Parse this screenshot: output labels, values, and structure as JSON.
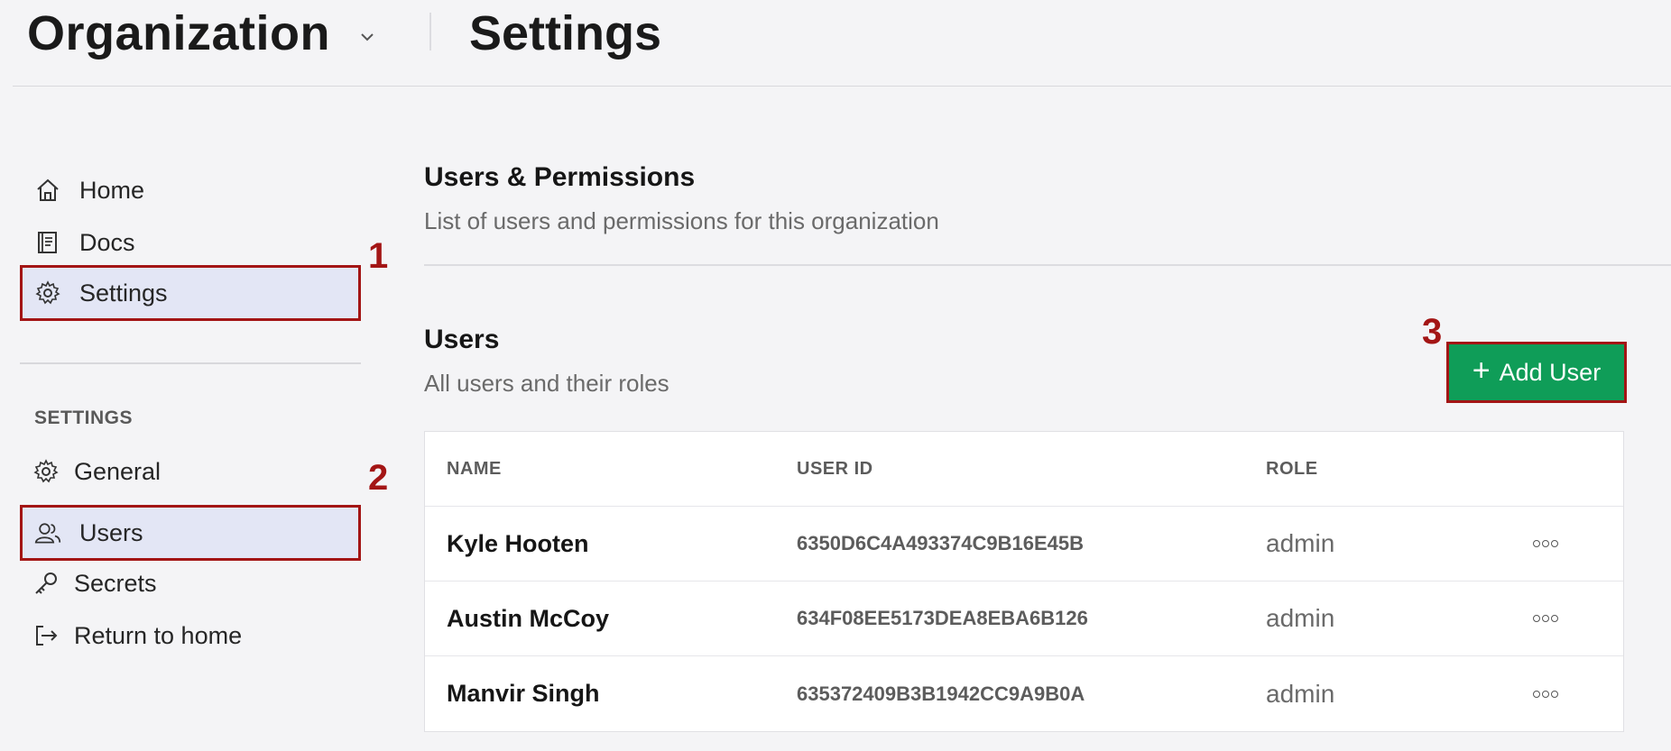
{
  "header": {
    "org_label": "Organization",
    "page_title": "Settings"
  },
  "sidebar": {
    "items": [
      {
        "label": "Home",
        "icon": "home-icon"
      },
      {
        "label": "Docs",
        "icon": "book-icon"
      },
      {
        "label": "Settings",
        "icon": "gear-icon",
        "active": true
      }
    ],
    "section_heading": "SETTINGS",
    "settings_items": [
      {
        "label": "General",
        "icon": "gear-icon"
      },
      {
        "label": "Users",
        "icon": "users-icon",
        "active": true
      },
      {
        "label": "Secrets",
        "icon": "key-icon"
      },
      {
        "label": "Return to home",
        "icon": "exit-icon"
      }
    ]
  },
  "markers": [
    "1",
    "2",
    "3"
  ],
  "main": {
    "permissions": {
      "title": "Users & Permissions",
      "subtitle": "List of users and permissions for this organization"
    },
    "users": {
      "title": "Users",
      "subtitle": "All users and their roles",
      "add_button_label": "Add User",
      "columns": [
        "NAME",
        "USER ID",
        "ROLE"
      ],
      "rows": [
        {
          "name": "Kyle Hooten",
          "user_id": "6350D6C4A493374C9B16E45B",
          "role": "admin"
        },
        {
          "name": "Austin McCoy",
          "user_id": "634F08EE5173DEA8EBA6B126",
          "role": "admin"
        },
        {
          "name": "Manvir Singh",
          "user_id": "635372409B3B1942CC9A9B0A",
          "role": "admin"
        }
      ]
    }
  },
  "colors": {
    "accent_green": "#0f9d58",
    "highlight_red": "#a31515",
    "active_nav_bg": "#e3e6f5"
  }
}
